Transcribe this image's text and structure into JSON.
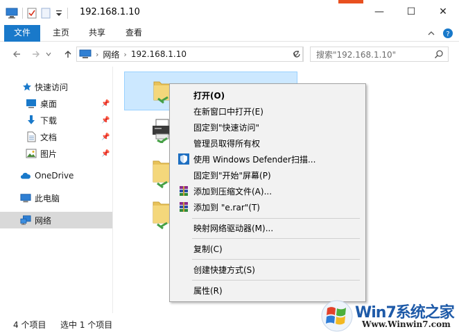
{
  "window": {
    "title": "192.168.1.10",
    "controls": [
      "—",
      "☐",
      "✕"
    ]
  },
  "ribbon": {
    "tabs": [
      "文件",
      "主页",
      "共享",
      "查看"
    ]
  },
  "address": {
    "crumbs": [
      "网络",
      "192.168.1.10"
    ],
    "search_placeholder": "搜索\"192.168.1.10\""
  },
  "sidebar": {
    "items": [
      {
        "label": "快速访问",
        "icon": "star-icon"
      },
      {
        "label": "桌面",
        "icon": "desktop-icon",
        "pinned": true
      },
      {
        "label": "下载",
        "icon": "download-icon",
        "pinned": true
      },
      {
        "label": "文档",
        "icon": "document-icon",
        "pinned": true
      },
      {
        "label": "图片",
        "icon": "picture-icon",
        "pinned": true
      },
      {
        "label": "OneDrive",
        "icon": "cloud-icon"
      },
      {
        "label": "此电脑",
        "icon": "computer-icon"
      },
      {
        "label": "网络",
        "icon": "network-icon",
        "selected": true
      }
    ]
  },
  "status": {
    "item_count": "4 个项目",
    "selected_count": "选中 1 个项目"
  },
  "context_menu": {
    "items": [
      {
        "label": "打开(O)",
        "bold": true
      },
      {
        "label": "在新窗口中打开(E)"
      },
      {
        "label": "固定到\"快速访问\""
      },
      {
        "label": "管理员取得所有权"
      },
      {
        "label": "使用 Windows Defender扫描...",
        "icon": "defender-shield-icon"
      },
      {
        "label": "固定到\"开始\"屏幕(P)"
      },
      {
        "label": "添加到压缩文件(A)...",
        "icon": "winrar-icon"
      },
      {
        "label": "添加到 \"e.rar\"(T)",
        "icon": "winrar-icon"
      },
      {
        "label": "映射网络驱动器(M)..."
      },
      {
        "label": "复制(C)"
      },
      {
        "label": "创建快捷方式(S)"
      },
      {
        "label": "属性(R)"
      }
    ]
  },
  "watermark": {
    "title": "Win7系统之家",
    "url": "Www.Winwin7.com"
  },
  "colors": {
    "accent": "#1979ca",
    "selection": "#cce8ff",
    "menu_bg": "#f2f2f2"
  }
}
